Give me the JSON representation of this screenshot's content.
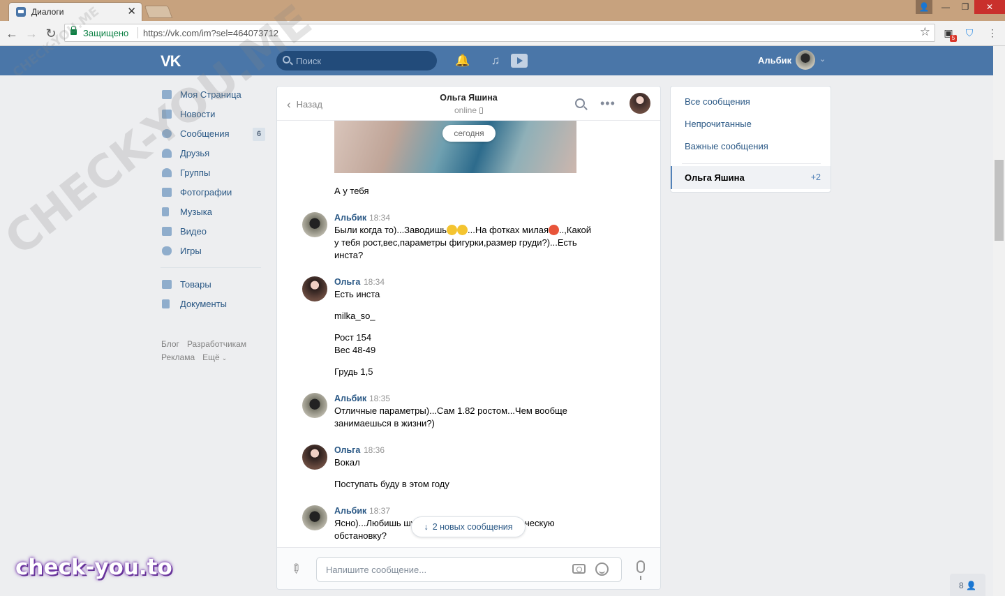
{
  "browser": {
    "tab_title": "Диалоги",
    "secure_label": "Защищено",
    "url": "https://vk.com/im?sel=464073712",
    "ext_badge": "5"
  },
  "header": {
    "search_placeholder": "Поиск",
    "user_name": "Альбик"
  },
  "leftnav": {
    "items": [
      {
        "label": "Моя Страница"
      },
      {
        "label": "Новости"
      },
      {
        "label": "Сообщения",
        "badge": "6"
      },
      {
        "label": "Друзья"
      },
      {
        "label": "Группы"
      },
      {
        "label": "Фотографии"
      },
      {
        "label": "Музыка"
      },
      {
        "label": "Видео"
      },
      {
        "label": "Игры"
      }
    ],
    "items2": [
      {
        "label": "Товары"
      },
      {
        "label": "Документы"
      }
    ],
    "footer": {
      "blog": "Блог",
      "dev": "Разработчикам",
      "ads": "Реклама",
      "more": "Ещё"
    }
  },
  "chat": {
    "back_label": "Назад",
    "title": "Ольга Яшина",
    "status": "online",
    "date_label": "сегодня",
    "new_messages": "2 новых сообщения",
    "input_placeholder": "Напишите сообщение...",
    "messages": [
      {
        "text": "А у тебя"
      },
      {
        "author": "Альбик",
        "time": "18:34",
        "text_a": "Были когда то)...Заводишь",
        "text_b": "...На фотках милая",
        "text_c": "..,Какой",
        "text_d": "у тебя рост,вес,параметры фигурки,размер груди?)...Есть",
        "text_e": "инста?"
      },
      {
        "author": "Ольга",
        "time": "18:34",
        "lines": [
          "Есть инста",
          "milka_so_",
          "Рост 154",
          "Вес 48-49",
          "Грудь 1,5"
        ]
      },
      {
        "author": "Альбик",
        "time": "18:35",
        "lines": [
          "Отличные параметры)...Сам 1.82 ростом...Чем вообще",
          "занимаешься в жизни?)"
        ]
      },
      {
        "author": "Ольга",
        "time": "18:36",
        "lines": [
          "Вокал",
          "Поступать буду в этом году"
        ]
      },
      {
        "author": "Альбик",
        "time": "18:37",
        "lines": [
          "Ясно)...Любишь шу",
          "ческую",
          "обстановку?"
        ]
      }
    ]
  },
  "rightpanel": {
    "all": "Все сообщения",
    "unread": "Непрочитанные",
    "important": "Важные сообщения",
    "active_name": "Ольга Яшина",
    "active_count": "+2"
  },
  "friends_online": "8",
  "watermark": {
    "big": "CHECK-YOU.ME",
    "small": "CHECK-YOU.ME",
    "brand": "check-you.to"
  },
  "colors": {
    "vk_blue": "#4a76a8",
    "link": "#2a5885",
    "bg": "#edeef0"
  }
}
